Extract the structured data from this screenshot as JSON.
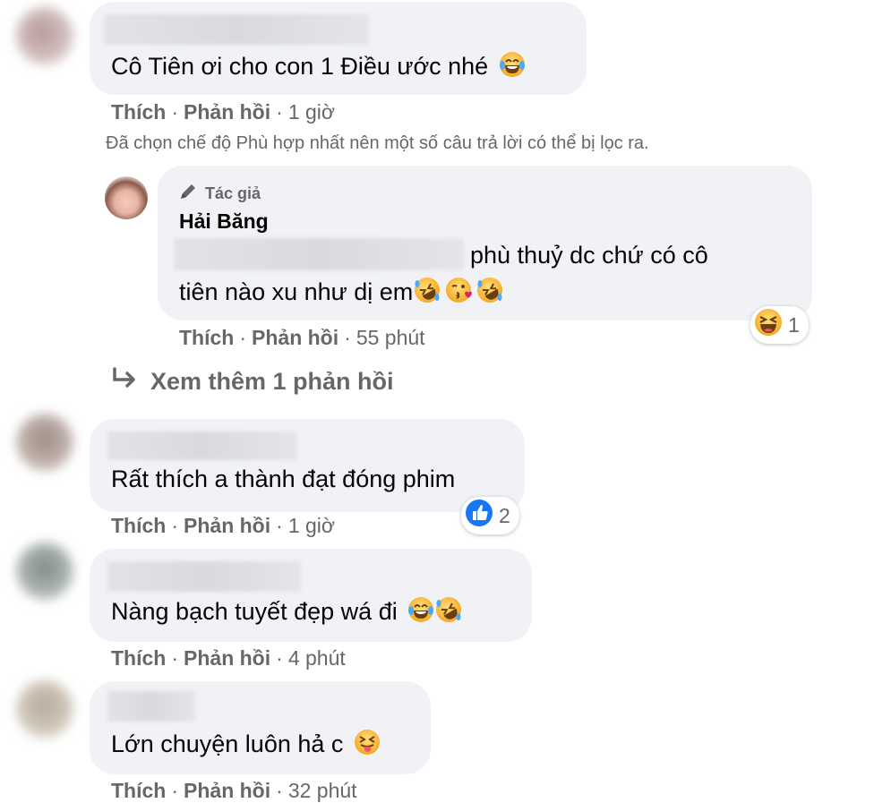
{
  "comments": [
    {
      "text": "Cô Tiên ơi cho con 1 Điều ước nhé",
      "actions": {
        "like": "Thích",
        "reply": "Phản hồi",
        "time": "1 giờ"
      }
    },
    {
      "text": "Rất thích a thành đạt đóng phim",
      "actions": {
        "like": "Thích",
        "reply": "Phản hồi",
        "time": "1 giờ"
      },
      "reaction_count": "2"
    },
    {
      "text": "Nàng bạch tuyết đẹp wá đi",
      "actions": {
        "like": "Thích",
        "reply": "Phản hồi",
        "time": "4 phút"
      }
    },
    {
      "text": "Lớn chuyện luôn hả c",
      "actions": {
        "like": "Thích",
        "reply": "Phản hồi",
        "time": "32 phút"
      }
    }
  ],
  "filter_notice": "Đã chọn chế độ Phù hợp nhất nên một số câu trả lời có thể bị lọc ra.",
  "reply": {
    "author_badge": "Tác giả",
    "author_name": "Hải Băng",
    "line1": "phù thuỷ dc chứ có cô",
    "line2": "tiên nào xu như dị em",
    "actions": {
      "like": "Thích",
      "reply": "Phản hồi",
      "time": "55 phút"
    },
    "reaction_count": "1"
  },
  "more_replies": "Xem thêm 1 phản hồi",
  "dot": "·",
  "colors": {
    "bubble": "#f0f2f5",
    "secondary_text": "#65676b",
    "like_blue": "#1877f2"
  },
  "icons": [
    "laugh-cry-emoji",
    "rofl-emoji",
    "kiss-emoji",
    "squint-laugh-emoji",
    "tongue-emoji",
    "like-icon",
    "pencil-icon",
    "reply-arrow-icon"
  ]
}
